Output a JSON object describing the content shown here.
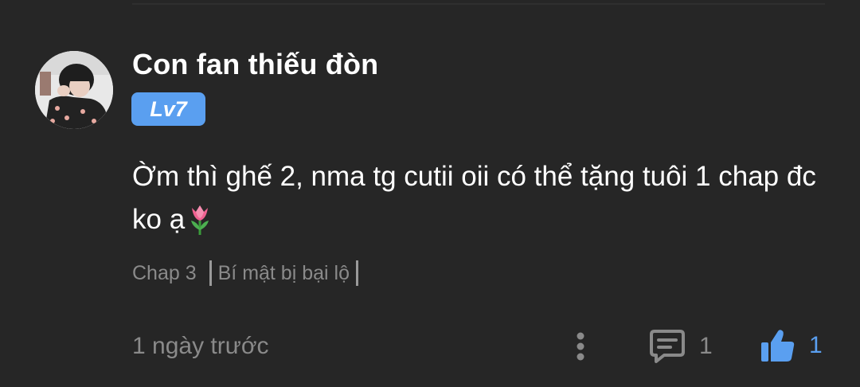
{
  "comment": {
    "username": "Con fan thiếu đòn",
    "level_badge": "Lv7",
    "text": "Ờm thì ghế 2, nma tg cutii oii có thể tặng tuôi 1 chap đc ko ạ",
    "emoji": "tulip-icon",
    "chapter": {
      "number": "Chap 3",
      "title": "Bí mật bị bại lộ"
    },
    "timestamp": "1 ngày trước",
    "reply_count": "1",
    "like_count": "1",
    "icons": {
      "more": "more-vertical-icon",
      "reply": "comment-bubble-icon",
      "like": "thumbs-up-icon"
    }
  },
  "colors": {
    "background": "#262626",
    "text": "#ffffff",
    "muted": "#8a8a8a",
    "accent": "#5a9ff0"
  }
}
